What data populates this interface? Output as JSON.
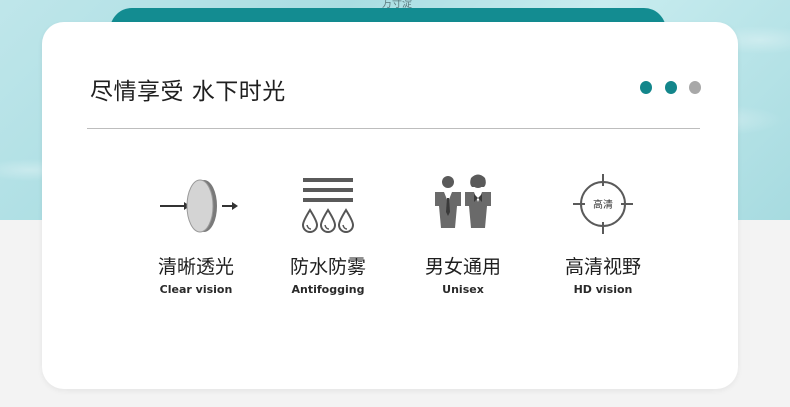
{
  "header": {
    "top_mark": "万寸淀",
    "title": "尽情享受 水下时光"
  },
  "dots": {
    "colors": [
      "#13868b",
      "#13868b",
      "#a8a8a8"
    ]
  },
  "features": [
    {
      "icon": "lens-clarity-icon",
      "cn": "清晰透光",
      "en": "Clear vision"
    },
    {
      "icon": "antifog-drops-icon",
      "cn": "防水防雾",
      "en": "Antifogging"
    },
    {
      "icon": "unisex-people-icon",
      "cn": "男女通用",
      "en": "Unisex"
    },
    {
      "icon": "crosshair-hd-icon",
      "cn": "高清视野",
      "en": "HD vision",
      "icon_text": "高清"
    }
  ],
  "colors": {
    "accent": "#138c91",
    "icon_gray": "#5a5a5a"
  }
}
